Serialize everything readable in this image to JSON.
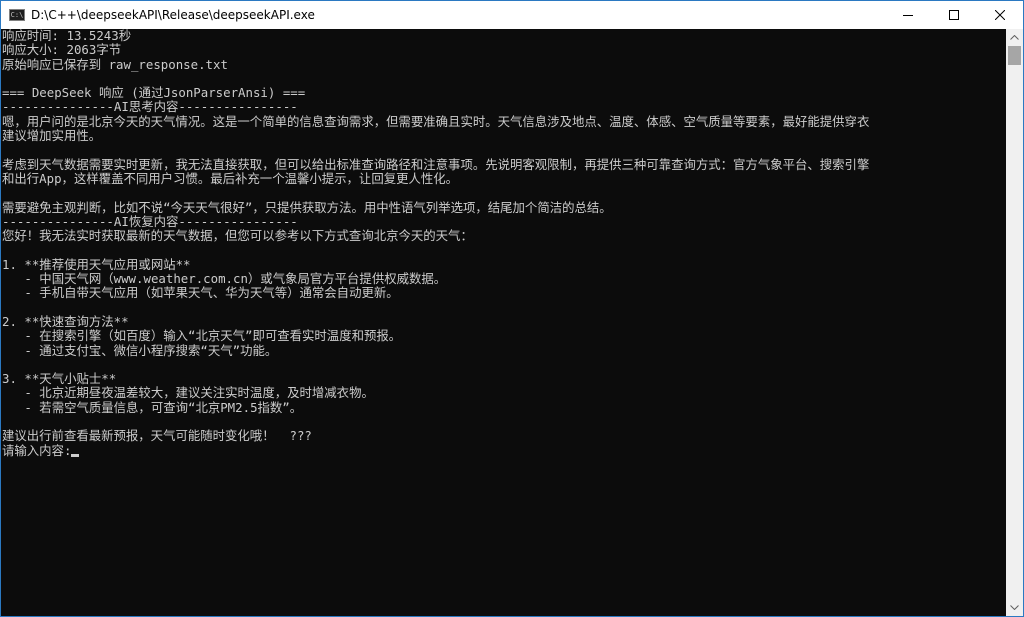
{
  "window": {
    "title": "D:\\C++\\deepseekAPI\\Release\\deepseekAPI.exe",
    "icon_label": "C:\\",
    "controls": [
      "minimize-icon",
      "maximize-icon",
      "close-icon"
    ]
  },
  "console": {
    "lines": [
      "响应时间: 13.5243秒",
      "响应大小: 2063字节",
      "原始响应已保存到 raw_response.txt",
      "",
      "=== DeepSeek 响应 (通过JsonParserAnsi) ===",
      "---------------AI思考内容----------------",
      "嗯，用户问的是北京今天的天气情况。这是一个简单的信息查询需求，但需要准确且实时。天气信息涉及地点、温度、体感、空气质量等要素，最好能提供穿衣",
      "建议增加实用性。",
      "",
      "考虑到天气数据需要实时更新，我无法直接获取，但可以给出标准查询路径和注意事项。先说明客观限制，再提供三种可靠查询方式：官方气象平台、搜索引擎",
      "和出行App，这样覆盖不同用户习惯。最后补充一个温馨小提示，让回复更人性化。",
      "",
      "需要避免主观判断，比如不说“今天天气很好”，只提供获取方法。用中性语气列举选项，结尾加个简洁的总结。",
      "---------------AI恢复内容----------------",
      "您好！我无法实时获取最新的天气数据，但您可以参考以下方式查询北京今天的天气：",
      "",
      "1. **推荐使用天气应用或网站**",
      "   - 中国天气网（www.weather.com.cn）或气象局官方平台提供权威数据。",
      "   - 手机自带天气应用（如苹果天气、华为天气等）通常会自动更新。",
      "",
      "2. **快速查询方法**",
      "   - 在搜索引擎（如百度）输入“北京天气”即可查看实时温度和预报。",
      "   - 通过支付宝、微信小程序搜索“天气”功能。",
      "",
      "3. **天气小贴士**",
      "   - 北京近期昼夜温差较大，建议关注实时温度，及时增减衣物。",
      "   - 若需空气质量信息，可查询“北京PM2.5指数”。",
      "",
      "建议出行前查看最新预报，天气可能随时变化哦！  ???",
      "请输入内容:"
    ]
  },
  "colors": {
    "console_bg": "#0c0c0c",
    "console_fg": "#cccccc",
    "titlebar_bg": "#ffffff",
    "scrollbar_track": "#f0f0f0",
    "scrollbar_thumb": "#a6a6a6"
  }
}
